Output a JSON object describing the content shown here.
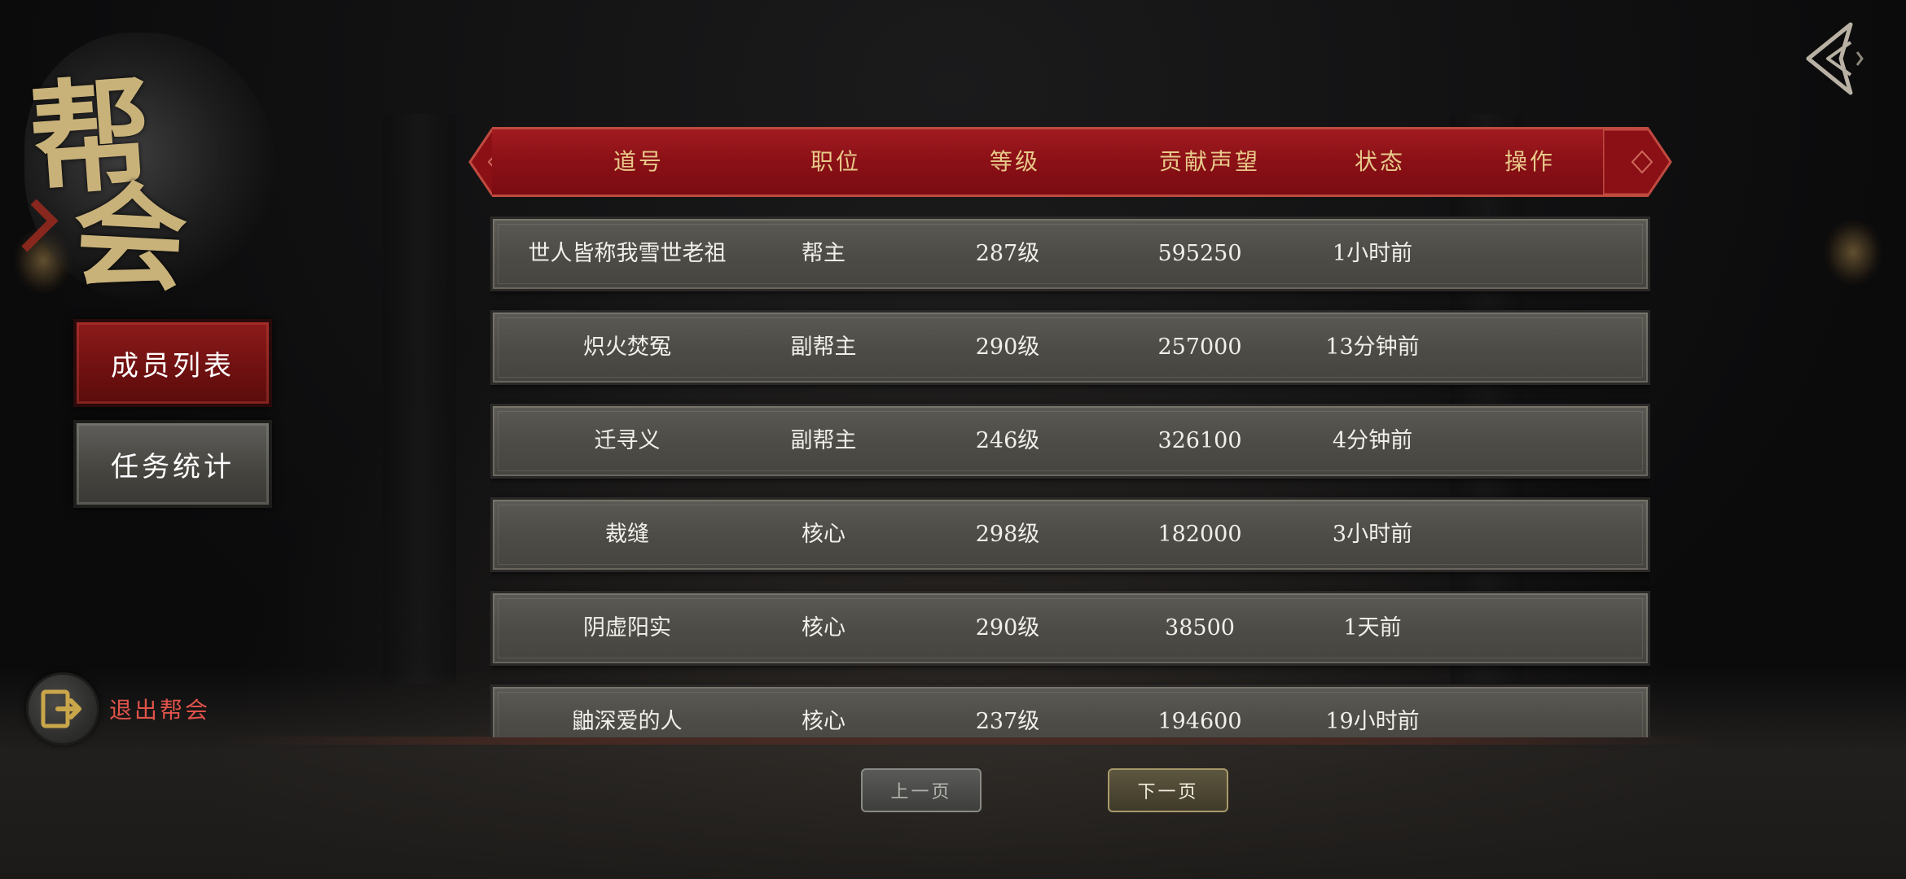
{
  "sidebar": {
    "title_chars": [
      "帮",
      "会"
    ],
    "tabs": [
      {
        "label": "成员列表",
        "active": true
      },
      {
        "label": "任务统计",
        "active": false
      }
    ],
    "quit_label": "退出帮会"
  },
  "table": {
    "headers": [
      "道号",
      "职位",
      "等级",
      "贡献声望",
      "状态",
      "操作"
    ],
    "rows": [
      {
        "name": "世人皆称我雪世老祖",
        "position": "帮主",
        "level": "287级",
        "contribution": "595250",
        "status": "1小时前"
      },
      {
        "name": "炽火焚冤",
        "position": "副帮主",
        "level": "290级",
        "contribution": "257000",
        "status": "13分钟前"
      },
      {
        "name": "迁寻义",
        "position": "副帮主",
        "level": "246级",
        "contribution": "326100",
        "status": "4分钟前"
      },
      {
        "name": "裁缝",
        "position": "核心",
        "level": "298级",
        "contribution": "182000",
        "status": "3小时前"
      },
      {
        "name": "阴虚阳实",
        "position": "核心",
        "level": "290级",
        "contribution": "38500",
        "status": "1天前"
      },
      {
        "name": "鼬深爱的人",
        "position": "核心",
        "level": "237级",
        "contribution": "194600",
        "status": "19小时前"
      }
    ]
  },
  "pagination": {
    "prev_label": "上一页",
    "next_label": "下一页"
  },
  "colors": {
    "header_red": "#8a1016",
    "header_text": "#e8c98a",
    "active_tab": "#7a1212",
    "quit_text": "#e0534a",
    "accent_gold": "#c9b27a"
  },
  "icons": {
    "back": "diamond-back-icon",
    "quit": "exit-door-icon"
  }
}
